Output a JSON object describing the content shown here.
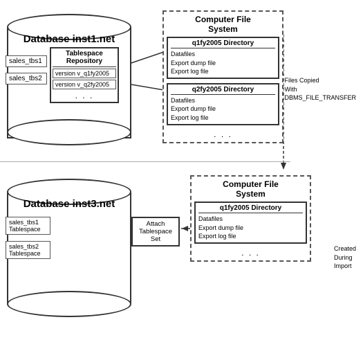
{
  "top": {
    "db": {
      "title": "Database inst1.net",
      "tbs1": "sales_tbs1",
      "tbs2": "sales_tbs2"
    },
    "repo": {
      "title": "Tablespace Repository",
      "version1": "version v_q1fy2005",
      "version2": "version v_q2fy2005",
      "dots": ". . ."
    },
    "cfs": {
      "title_line1": "Computer File",
      "title_line2": "System",
      "dir1": {
        "title": "q1fy2005 Directory",
        "item1": "Datafiles",
        "item2": "Export dump file",
        "item3": "Export log file"
      },
      "dir2": {
        "title": "q2fy2005 Directory",
        "item1": "Datafiles",
        "item2": "Export dump file",
        "item3": "Export log file"
      },
      "dots": ". . ."
    },
    "filesCopied": {
      "line1": "Files Copied",
      "line2": "With",
      "line3": "DBMS_FILE_TRANSFER"
    }
  },
  "bottom": {
    "db": {
      "title": "Database inst3.net",
      "tbs1_line1": "sales_tbs1",
      "tbs1_line2": "Tablespace",
      "tbs2_line1": "sales_tbs2",
      "tbs2_line2": "Tablespace"
    },
    "attachBox": {
      "line1": "Attach",
      "line2": "Tablespace",
      "line3": "Set"
    },
    "cfs": {
      "title_line1": "Computer File",
      "title_line2": "System",
      "dir1": {
        "title": "q1fy2005 Directory",
        "item1": "Datafiles",
        "item2": "Export dump file",
        "item3": "Export log file"
      },
      "dots": ". . ."
    },
    "createdLabel": {
      "line1": "Created",
      "line2": "During",
      "line3": "Import"
    }
  }
}
